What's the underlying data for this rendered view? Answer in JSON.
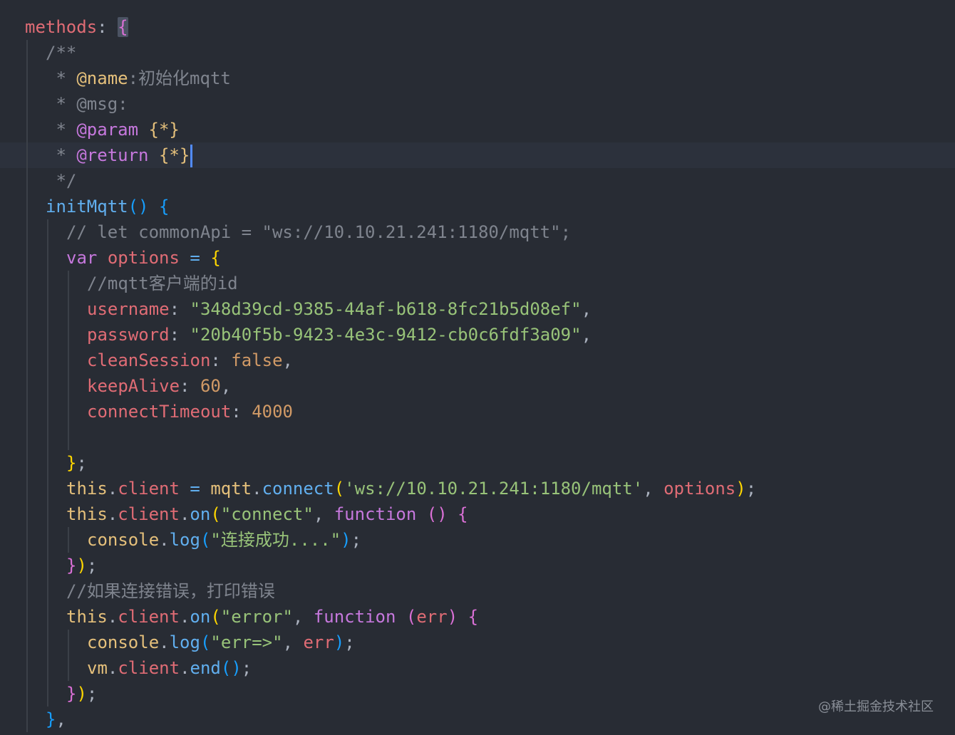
{
  "editor": {
    "lines": [
      {
        "indent": 0,
        "tokens": [
          {
            "t": "methods",
            "c": "key"
          },
          {
            "t": ": ",
            "c": "plain"
          },
          {
            "t": "{",
            "c": "brace-hl"
          }
        ]
      },
      {
        "indent": 1,
        "tokens": [
          {
            "t": "/**",
            "c": "comment"
          }
        ]
      },
      {
        "indent": 1,
        "tokens": [
          {
            "t": " * ",
            "c": "comment"
          },
          {
            "t": "@name",
            "c": "type"
          },
          {
            "t": ":初始化mqtt",
            "c": "comment"
          }
        ]
      },
      {
        "indent": 1,
        "tokens": [
          {
            "t": " * @msg:",
            "c": "comment"
          }
        ]
      },
      {
        "indent": 1,
        "tokens": [
          {
            "t": " * ",
            "c": "comment"
          },
          {
            "t": "@param",
            "c": "tag"
          },
          {
            "t": " ",
            "c": "comment"
          },
          {
            "t": "{*}",
            "c": "type"
          }
        ]
      },
      {
        "indent": 1,
        "current": true,
        "cursor": true,
        "tokens": [
          {
            "t": " * ",
            "c": "comment"
          },
          {
            "t": "@return",
            "c": "tag"
          },
          {
            "t": " ",
            "c": "comment"
          },
          {
            "t": "{*}",
            "c": "type"
          }
        ]
      },
      {
        "indent": 1,
        "tokens": [
          {
            "t": " */",
            "c": "comment"
          }
        ]
      },
      {
        "indent": 1,
        "tokens": [
          {
            "t": "initMqtt",
            "c": "fn"
          },
          {
            "t": "()",
            "c": "br3"
          },
          {
            "t": " ",
            "c": "plain"
          },
          {
            "t": "{",
            "c": "br3"
          }
        ]
      },
      {
        "indent": 2,
        "tokens": [
          {
            "t": "// let commonApi = \"ws://10.10.21.241:1180/mqtt\";",
            "c": "comment"
          }
        ]
      },
      {
        "indent": 2,
        "tokens": [
          {
            "t": "var",
            "c": "keyword"
          },
          {
            "t": " ",
            "c": "plain"
          },
          {
            "t": "options",
            "c": "var"
          },
          {
            "t": " ",
            "c": "plain"
          },
          {
            "t": "=",
            "c": "fn"
          },
          {
            "t": " ",
            "c": "plain"
          },
          {
            "t": "{",
            "c": "br1"
          }
        ]
      },
      {
        "indent": 3,
        "tokens": [
          {
            "t": "//mqtt客户端的id",
            "c": "comment"
          }
        ]
      },
      {
        "indent": 3,
        "tokens": [
          {
            "t": "username",
            "c": "keyprop"
          },
          {
            "t": ": ",
            "c": "plain"
          },
          {
            "t": "\"348d39cd-9385-44af-b618-8fc21b5d08ef\"",
            "c": "str"
          },
          {
            "t": ",",
            "c": "plain"
          }
        ]
      },
      {
        "indent": 3,
        "tokens": [
          {
            "t": "password",
            "c": "keyprop"
          },
          {
            "t": ": ",
            "c": "plain"
          },
          {
            "t": "\"20b40f5b-9423-4e3c-9412-cb0c6fdf3a09\"",
            "c": "str"
          },
          {
            "t": ",",
            "c": "plain"
          }
        ]
      },
      {
        "indent": 3,
        "tokens": [
          {
            "t": "cleanSession",
            "c": "keyprop"
          },
          {
            "t": ": ",
            "c": "plain"
          },
          {
            "t": "false",
            "c": "bool"
          },
          {
            "t": ",",
            "c": "plain"
          }
        ]
      },
      {
        "indent": 3,
        "tokens": [
          {
            "t": "keepAlive",
            "c": "keyprop"
          },
          {
            "t": ": ",
            "c": "plain"
          },
          {
            "t": "60",
            "c": "num"
          },
          {
            "t": ",",
            "c": "plain"
          }
        ]
      },
      {
        "indent": 3,
        "tokens": [
          {
            "t": "connectTimeout",
            "c": "keyprop"
          },
          {
            "t": ": ",
            "c": "plain"
          },
          {
            "t": "4000",
            "c": "num"
          }
        ]
      },
      {
        "indent": 3,
        "tokens": []
      },
      {
        "indent": 2,
        "tokens": [
          {
            "t": "}",
            "c": "br1"
          },
          {
            "t": ";",
            "c": "plain"
          }
        ]
      },
      {
        "indent": 2,
        "tokens": [
          {
            "t": "this",
            "c": "this"
          },
          {
            "t": ".",
            "c": "plain"
          },
          {
            "t": "client",
            "c": "var"
          },
          {
            "t": " ",
            "c": "plain"
          },
          {
            "t": "=",
            "c": "fn"
          },
          {
            "t": " ",
            "c": "plain"
          },
          {
            "t": "mqtt",
            "c": "this"
          },
          {
            "t": ".",
            "c": "plain"
          },
          {
            "t": "connect",
            "c": "method"
          },
          {
            "t": "(",
            "c": "br1"
          },
          {
            "t": "'ws://10.10.21.241:1180/mqtt'",
            "c": "str"
          },
          {
            "t": ", ",
            "c": "plain"
          },
          {
            "t": "options",
            "c": "var"
          },
          {
            "t": ")",
            "c": "br1"
          },
          {
            "t": ";",
            "c": "plain"
          }
        ]
      },
      {
        "indent": 2,
        "tokens": [
          {
            "t": "this",
            "c": "this"
          },
          {
            "t": ".",
            "c": "plain"
          },
          {
            "t": "client",
            "c": "var"
          },
          {
            "t": ".",
            "c": "plain"
          },
          {
            "t": "on",
            "c": "method"
          },
          {
            "t": "(",
            "c": "br1"
          },
          {
            "t": "\"connect\"",
            "c": "str"
          },
          {
            "t": ", ",
            "c": "plain"
          },
          {
            "t": "function",
            "c": "keyword"
          },
          {
            "t": " ",
            "c": "plain"
          },
          {
            "t": "()",
            "c": "br2"
          },
          {
            "t": " ",
            "c": "plain"
          },
          {
            "t": "{",
            "c": "br2"
          }
        ]
      },
      {
        "indent": 3,
        "tokens": [
          {
            "t": "console",
            "c": "this"
          },
          {
            "t": ".",
            "c": "plain"
          },
          {
            "t": "log",
            "c": "method"
          },
          {
            "t": "(",
            "c": "br3"
          },
          {
            "t": "\"连接成功....\"",
            "c": "str"
          },
          {
            "t": ")",
            "c": "br3"
          },
          {
            "t": ";",
            "c": "plain"
          }
        ]
      },
      {
        "indent": 2,
        "tokens": [
          {
            "t": "}",
            "c": "br2"
          },
          {
            "t": ")",
            "c": "br1"
          },
          {
            "t": ";",
            "c": "plain"
          }
        ]
      },
      {
        "indent": 2,
        "tokens": [
          {
            "t": "//如果连接错误，打印错误",
            "c": "comment"
          }
        ]
      },
      {
        "indent": 2,
        "tokens": [
          {
            "t": "this",
            "c": "this"
          },
          {
            "t": ".",
            "c": "plain"
          },
          {
            "t": "client",
            "c": "var"
          },
          {
            "t": ".",
            "c": "plain"
          },
          {
            "t": "on",
            "c": "method"
          },
          {
            "t": "(",
            "c": "br1"
          },
          {
            "t": "\"error\"",
            "c": "str"
          },
          {
            "t": ", ",
            "c": "plain"
          },
          {
            "t": "function",
            "c": "keyword"
          },
          {
            "t": " ",
            "c": "plain"
          },
          {
            "t": "(",
            "c": "br2"
          },
          {
            "t": "err",
            "c": "var"
          },
          {
            "t": ")",
            "c": "br2"
          },
          {
            "t": " ",
            "c": "plain"
          },
          {
            "t": "{",
            "c": "br2"
          }
        ]
      },
      {
        "indent": 3,
        "tokens": [
          {
            "t": "console",
            "c": "this"
          },
          {
            "t": ".",
            "c": "plain"
          },
          {
            "t": "log",
            "c": "method"
          },
          {
            "t": "(",
            "c": "br3"
          },
          {
            "t": "\"err=>\"",
            "c": "str"
          },
          {
            "t": ", ",
            "c": "plain"
          },
          {
            "t": "err",
            "c": "var"
          },
          {
            "t": ")",
            "c": "br3"
          },
          {
            "t": ";",
            "c": "plain"
          }
        ]
      },
      {
        "indent": 3,
        "tokens": [
          {
            "t": "vm",
            "c": "this"
          },
          {
            "t": ".",
            "c": "plain"
          },
          {
            "t": "client",
            "c": "var"
          },
          {
            "t": ".",
            "c": "plain"
          },
          {
            "t": "end",
            "c": "method"
          },
          {
            "t": "()",
            "c": "br3"
          },
          {
            "t": ";",
            "c": "plain"
          }
        ]
      },
      {
        "indent": 2,
        "tokens": [
          {
            "t": "}",
            "c": "br2"
          },
          {
            "t": ")",
            "c": "br1"
          },
          {
            "t": ";",
            "c": "plain"
          }
        ]
      },
      {
        "indent": 1,
        "tokens": [
          {
            "t": "}",
            "c": "br3"
          },
          {
            "t": ",",
            "c": "plain"
          }
        ]
      }
    ]
  },
  "watermark": "@稀土掘金技术社区"
}
